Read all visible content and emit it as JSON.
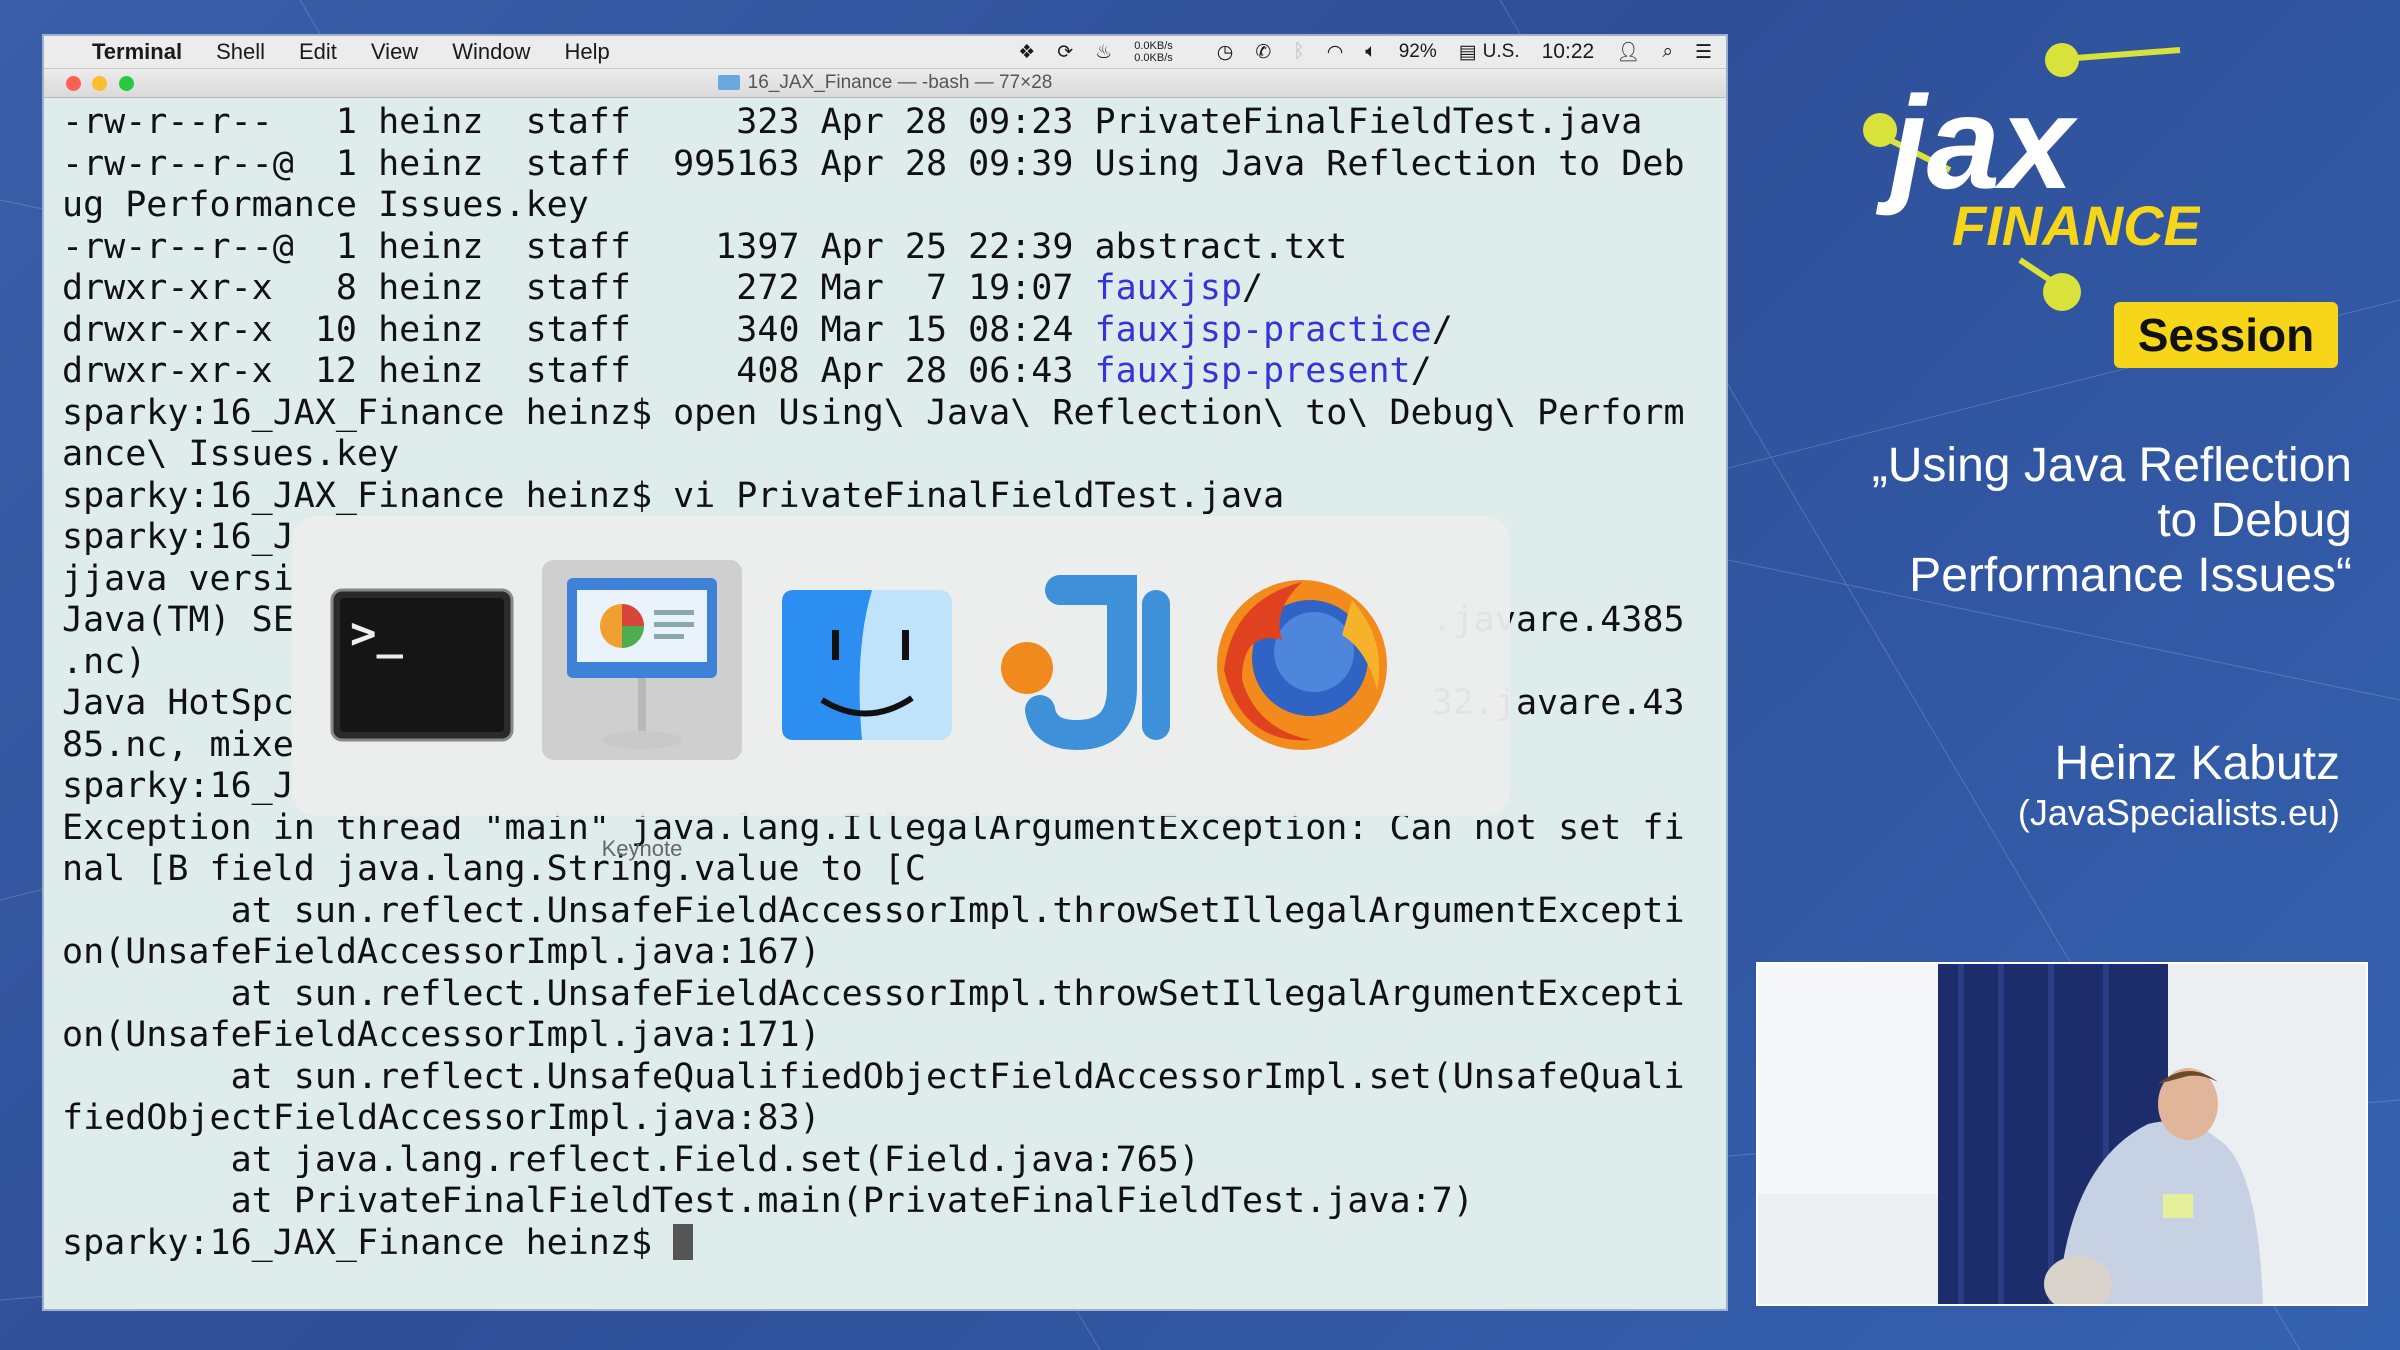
{
  "menubar": {
    "app_name": "Terminal",
    "menus": [
      "Shell",
      "Edit",
      "View",
      "Window",
      "Help"
    ],
    "net_up": "0.0KB/s",
    "net_down": "0.0KB/s",
    "battery": "92%",
    "input_source": "U.S.",
    "clock": "10:22"
  },
  "window": {
    "title": "16_JAX_Finance — -bash — 77×28"
  },
  "terminal": {
    "lines": [
      [
        {
          "t": "-rw-r--r--   1 heinz  staff     323 Apr 28 09:23 PrivateFinalFieldTest.java"
        }
      ],
      [
        {
          "t": "-rw-r--r--@  1 heinz  staff  995163 Apr 28 09:39 Using Java Reflection to Deb"
        }
      ],
      [
        {
          "t": "ug Performance Issues.key"
        }
      ],
      [
        {
          "t": "-rw-r--r--@  1 heinz  staff    1397 Apr 25 22:39 abstract.txt"
        }
      ],
      [
        {
          "t": "drwxr-xr-x   8 heinz  staff     272 Mar  7 19:07 "
        },
        {
          "t": "fauxjsp",
          "c": "dir"
        },
        {
          "t": "/"
        }
      ],
      [
        {
          "t": "drwxr-xr-x  10 heinz  staff     340 Mar 15 08:24 "
        },
        {
          "t": "fauxjsp-practice",
          "c": "dir"
        },
        {
          "t": "/"
        }
      ],
      [
        {
          "t": "drwxr-xr-x  12 heinz  staff     408 Apr 28 06:43 "
        },
        {
          "t": "fauxjsp-present",
          "c": "dir"
        },
        {
          "t": "/"
        }
      ],
      [
        {
          "t": "sparky:16_JAX_Finance heinz$ open Using\\ Java\\ Reflection\\ to\\ Debug\\ Perform"
        }
      ],
      [
        {
          "t": "ance\\ Issues.key"
        }
      ],
      [
        {
          "t": "sparky:16_JAX_Finance heinz$ vi PrivateFinalFieldTest.java"
        }
      ],
      [
        {
          "t": "sparky:16_J"
        }
      ],
      [
        {
          "t": "jjava versi"
        }
      ],
      [
        {
          "t": "Java(TM) SE                                                      .javare.4385"
        }
      ],
      [
        {
          "t": ".nc)"
        }
      ],
      [
        {
          "t": "Java HotSpc                                                      32.javare.43"
        }
      ],
      [
        {
          "t": "85.nc, mixe"
        }
      ],
      [
        {
          "t": "sparky:16_J"
        }
      ],
      [
        {
          "t": "Exception in thread \"main\" java.lang.IllegalArgumentException: Can not set fi"
        }
      ],
      [
        {
          "t": "nal [B field java.lang.String.value to [C"
        }
      ],
      [
        {
          "t": "        at sun.reflect.UnsafeFieldAccessorImpl.throwSetIllegalArgumentExcepti"
        }
      ],
      [
        {
          "t": "on(UnsafeFieldAccessorImpl.java:167)"
        }
      ],
      [
        {
          "t": "        at sun.reflect.UnsafeFieldAccessorImpl.throwSetIllegalArgumentExcepti"
        }
      ],
      [
        {
          "t": "on(UnsafeFieldAccessorImpl.java:171)"
        }
      ],
      [
        {
          "t": "        at sun.reflect.UnsafeQualifiedObjectFieldAccessorImpl.set(UnsafeQuali"
        }
      ],
      [
        {
          "t": "fiedObjectFieldAccessorImpl.java:83)"
        }
      ],
      [
        {
          "t": "        at java.lang.reflect.Field.set(Field.java:765)"
        }
      ],
      [
        {
          "t": "        at PrivateFinalFieldTest.main(PrivateFinalFieldTest.java:7)"
        }
      ],
      [
        {
          "t": "sparky:16_JAX_Finance heinz$ "
        },
        {
          "t": "",
          "c": "cursor"
        }
      ]
    ]
  },
  "app_switcher": {
    "apps": [
      {
        "id": "terminal",
        "icon": "terminal-icon",
        "label": ""
      },
      {
        "id": "keynote",
        "icon": "keynote-icon",
        "label": "Keynote",
        "selected": true
      },
      {
        "id": "finder",
        "icon": "finder-icon",
        "label": ""
      },
      {
        "id": "intellij",
        "icon": "intellij-idea-icon",
        "label": ""
      },
      {
        "id": "firefox",
        "icon": "firefox-icon",
        "label": ""
      }
    ]
  },
  "conference": {
    "logo_word": "jax",
    "logo_sub": "FINANCE",
    "badge": "Session",
    "talk_title": "„Using Java Reflection\nto Debug\nPerformance Issues“",
    "speaker_name": "Heinz Kabutz",
    "speaker_org": "(JavaSpecialists.eu)",
    "brand_colors": {
      "yellow": "#f7d519",
      "blue": "#3a5ea8"
    }
  }
}
